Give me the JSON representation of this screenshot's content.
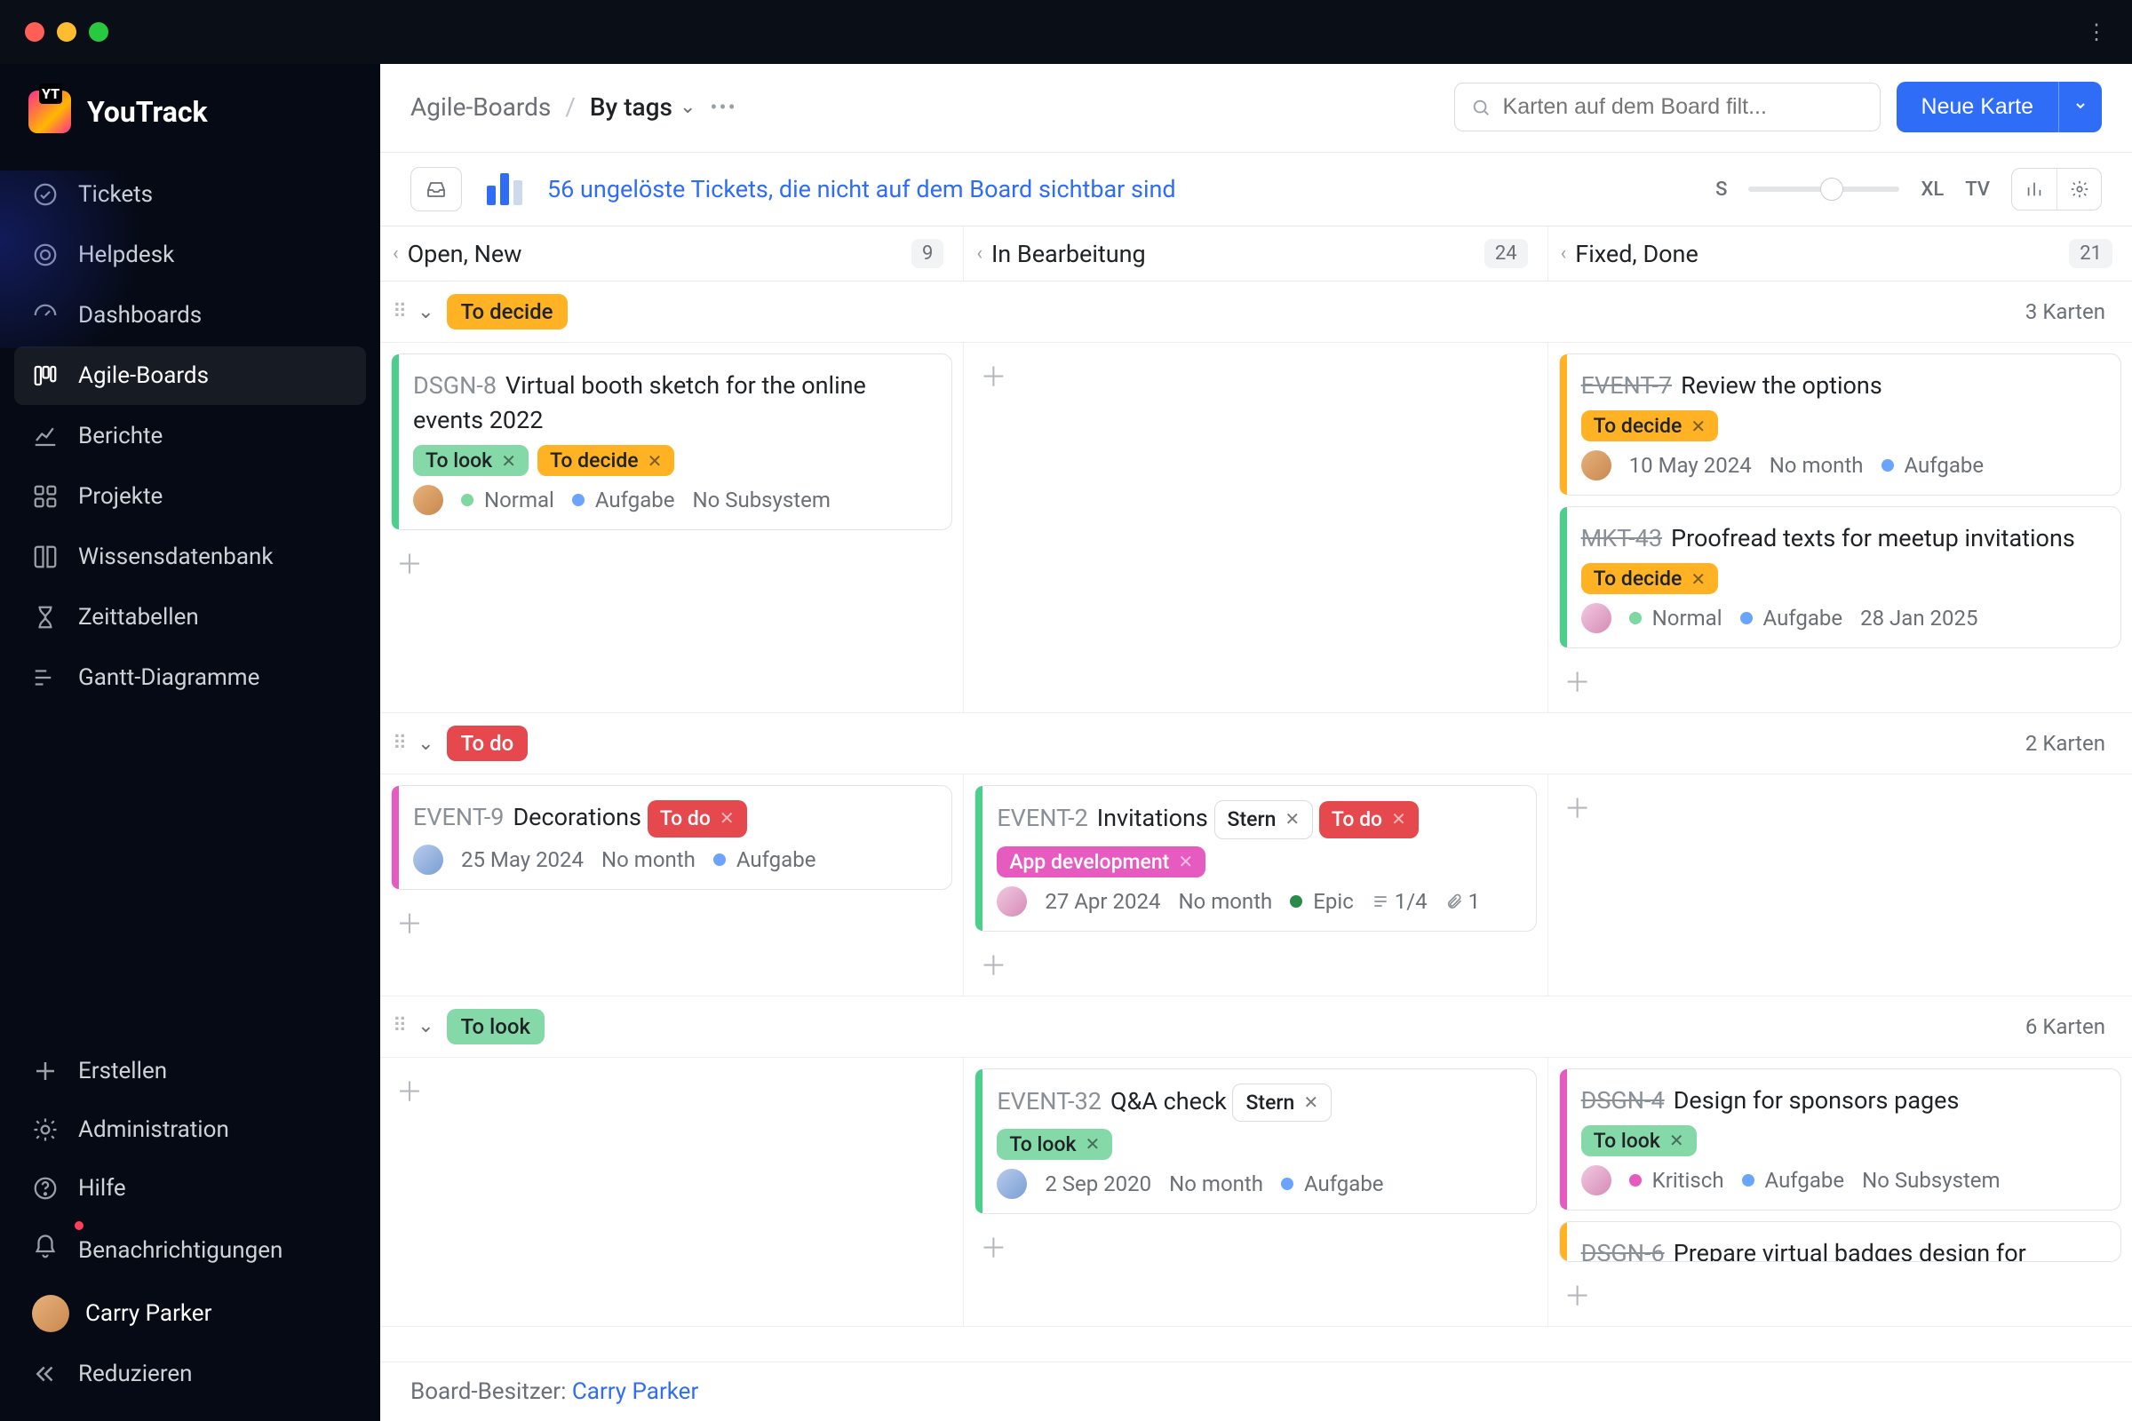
{
  "titlebar": {},
  "logo": {
    "text": "YouTrack"
  },
  "sidebar": {
    "items": [
      {
        "label": "Tickets"
      },
      {
        "label": "Helpdesk"
      },
      {
        "label": "Dashboards"
      },
      {
        "label": "Agile-Boards"
      },
      {
        "label": "Berichte"
      },
      {
        "label": "Projekte"
      },
      {
        "label": "Wissensdatenbank"
      },
      {
        "label": "Zeittabellen"
      },
      {
        "label": "Gantt-Diagramme"
      }
    ],
    "bottom": [
      {
        "label": "Erstellen"
      },
      {
        "label": "Administration"
      },
      {
        "label": "Hilfe"
      },
      {
        "label": "Benachrichtigungen"
      }
    ],
    "user": {
      "name": "Carry Parker"
    },
    "collapse": "Reduzieren"
  },
  "breadcrumb": {
    "root": "Agile-Boards",
    "current": "By tags"
  },
  "search": {
    "placeholder": "Karten auf dem Board filt..."
  },
  "buttons": {
    "new_card": "Neue Karte"
  },
  "filterbar": {
    "unresolved": "56 ungelöste Tickets, die nicht auf dem Board sichtbar sind",
    "zoom": {
      "s": "S",
      "xl": "XL",
      "tv": "TV",
      "pos": 55
    }
  },
  "columns": [
    {
      "title": "Open, New",
      "count": "9"
    },
    {
      "title": "In Bearbeitung",
      "count": "24"
    },
    {
      "title": "Fixed, Done",
      "count": "21"
    }
  ],
  "swimlanes": [
    {
      "tag": "To decide",
      "tagClass": "to-decide",
      "count": "3 Karten",
      "cells": [
        [
          {
            "id": "DSGN-8",
            "title": "Virtual booth sketch for the online events 2022",
            "stripe": "green",
            "tags": [
              {
                "t": "To look",
                "c": "to-look"
              },
              {
                "t": "To decide",
                "c": "to-decide"
              }
            ],
            "meta": {
              "avatar": "a1",
              "rows": [
                {
                  "dot": "green",
                  "text": "Normal"
                },
                {
                  "dot": "blue",
                  "text": "Aufgabe"
                },
                {
                  "text": "No Subsystem"
                }
              ]
            }
          }
        ],
        [],
        [
          {
            "id": "EVENT-7",
            "done": true,
            "title": "Review the options",
            "stripe": "yellow",
            "tags": [
              {
                "t": "To decide",
                "c": "to-decide"
              }
            ],
            "meta": {
              "avatar": "a1",
              "rows": [
                {
                  "text": "10 May 2024"
                },
                {
                  "text": "No month"
                },
                {
                  "dot": "blue",
                  "text": "Aufgabe"
                }
              ]
            }
          },
          {
            "id": "MKT-43",
            "done": true,
            "title": "Proofread texts for meetup invitations",
            "stripe": "green",
            "tags": [
              {
                "t": "To decide",
                "c": "to-decide"
              }
            ],
            "meta": {
              "avatar": "a3",
              "rows": [
                {
                  "dot": "green",
                  "text": "Normal"
                },
                {
                  "dot": "blue",
                  "text": "Aufgabe"
                },
                {
                  "text": "28 Jan 2025"
                }
              ]
            }
          }
        ]
      ]
    },
    {
      "tag": "To do",
      "tagClass": "to-do",
      "count": "2 Karten",
      "cells": [
        [
          {
            "id": "EVENT-9",
            "title": "Decorations",
            "stripe": "pink",
            "tagsInline": [
              {
                "t": "To do",
                "c": "to-do"
              }
            ],
            "meta": {
              "avatar": "a2",
              "rows": [
                {
                  "text": "25 May 2024"
                },
                {
                  "text": "No month"
                },
                {
                  "dot": "blue",
                  "text": "Aufgabe"
                }
              ]
            }
          }
        ],
        [
          {
            "id": "EVENT-2",
            "title": "Invitations",
            "stripe": "green",
            "tagsInline": [
              {
                "t": "Stern",
                "c": "stern"
              },
              {
                "t": "To do",
                "c": "to-do"
              }
            ],
            "tags": [
              {
                "t": "App development",
                "c": "app-dev"
              }
            ],
            "meta": {
              "avatar": "a3",
              "rows": [
                {
                  "text": "27 Apr 2024"
                },
                {
                  "text": "No month"
                },
                {
                  "dot": "darkgreen",
                  "text": "Epic"
                }
              ],
              "tasks": "1/4",
              "attach": "1"
            }
          }
        ],
        []
      ]
    },
    {
      "tag": "To look",
      "tagClass": "to-look",
      "count": "6 Karten",
      "cells": [
        [],
        [
          {
            "id": "EVENT-32",
            "title": "Q&A check",
            "stripe": "green",
            "tagsInline": [
              {
                "t": "Stern",
                "c": "stern"
              }
            ],
            "tags": [
              {
                "t": "To look",
                "c": "to-look"
              }
            ],
            "meta": {
              "avatar": "a2",
              "rows": [
                {
                  "text": "2 Sep 2020"
                },
                {
                  "text": "No month"
                },
                {
                  "dot": "blue",
                  "text": "Aufgabe"
                }
              ]
            }
          }
        ],
        [
          {
            "id": "DSGN-4",
            "done": true,
            "title": "Design for sponsors pages",
            "stripe": "pink",
            "tags": [
              {
                "t": "To look",
                "c": "to-look"
              }
            ],
            "meta": {
              "avatar": "a3",
              "rows": [
                {
                  "dot": "pink",
                  "text": "Kritisch"
                },
                {
                  "dot": "blue",
                  "text": "Aufgabe"
                },
                {
                  "text": "No Subsystem"
                }
              ]
            }
          },
          {
            "id": "DSGN-6",
            "done": true,
            "title": "Prepare virtual badges design for",
            "stripe": "yellow",
            "partial": true
          }
        ]
      ]
    }
  ],
  "footer": {
    "label": "Board-Besitzer: ",
    "owner": "Carry Parker"
  }
}
